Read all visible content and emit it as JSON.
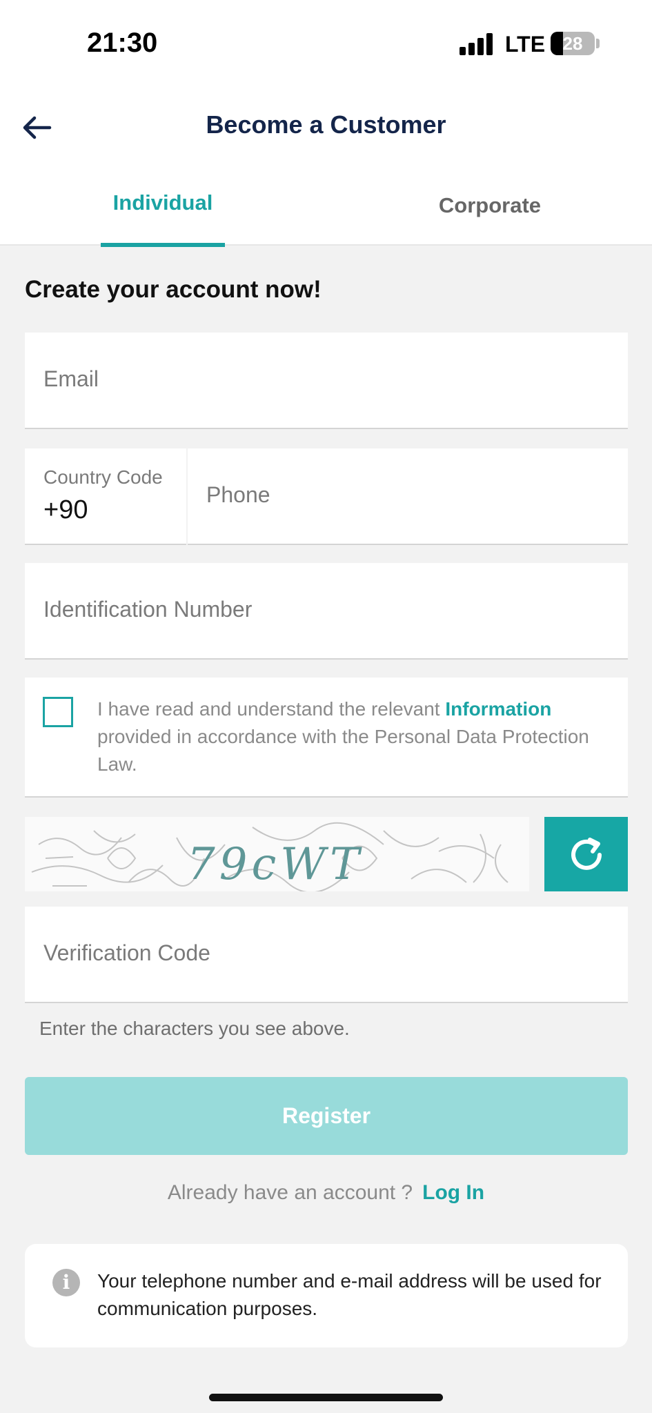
{
  "status_bar": {
    "time": "21:30",
    "network": "LTE",
    "battery": "28"
  },
  "header": {
    "title": "Become a Customer",
    "back_icon": "arrow-left-icon"
  },
  "tabs": [
    {
      "label": "Individual",
      "active": true
    },
    {
      "label": "Corporate",
      "active": false
    }
  ],
  "form": {
    "title": "Create your account now!",
    "email_placeholder": "Email",
    "country_code_label": "Country Code",
    "country_code_value": "+90",
    "phone_placeholder": "Phone",
    "id_placeholder": "Identification Number",
    "consent": {
      "checked": false,
      "text_before": "I have read and understand the relevant ",
      "link": "Information",
      "text_after": " provided in accordance with the Personal Data Protection Law."
    },
    "captcha": {
      "text": "79cWT",
      "refresh_icon": "refresh-icon"
    },
    "verification_placeholder": "Verification Code",
    "verification_helper": "Enter the characters you see above.",
    "register_label": "Register"
  },
  "login": {
    "question": "Already have an account ?",
    "link": "Log In"
  },
  "info": {
    "icon": "info-icon",
    "text": "Your telephone number and e-mail address will be used for communication purposes."
  },
  "colors": {
    "accent": "#1aa3a3",
    "register_disabled": "#98dbda",
    "title": "#14254a",
    "background": "#f2f2f2"
  }
}
